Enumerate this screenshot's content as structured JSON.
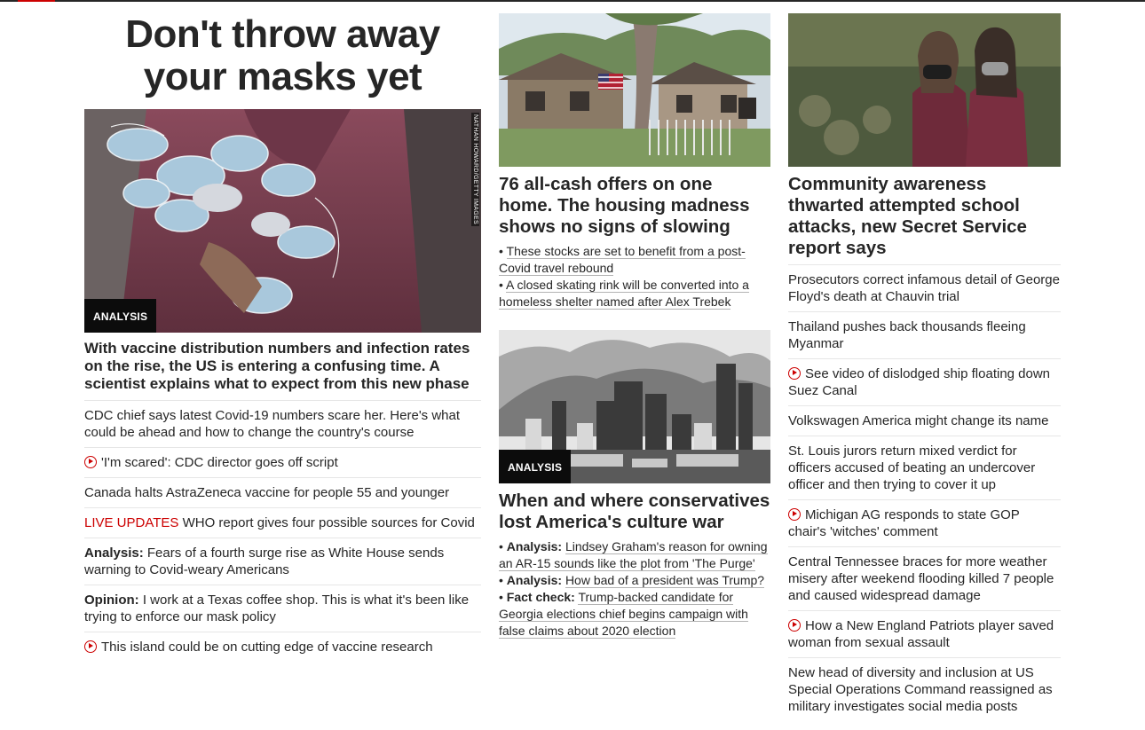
{
  "column1": {
    "banner": "Don't throw away your masks yet",
    "image": {
      "badge": "ANALYSIS",
      "credit": "NATHAN HOWARD/GETTY IMAGES"
    },
    "headline": "With vaccine distribution numbers and infection rates on the rise, the US is entering a confusing time. A scientist explains what to expect from this new phase",
    "items": [
      {
        "text": "CDC chief says latest Covid-19 numbers scare her. Here's what could be ahead and how to change the country's course"
      },
      {
        "text": "'I'm scared': CDC director goes off script",
        "icon": "play-icon"
      },
      {
        "text": "Canada halts AstraZeneca vaccine for people 55 and younger"
      },
      {
        "prefix": "LIVE UPDATES",
        "text": "WHO report gives four possible sources for Covid"
      },
      {
        "prefix": "Analysis:",
        "text": "Fears of a fourth surge rise as White House sends warning to Covid-weary Americans"
      },
      {
        "prefix": "Opinion:",
        "text": "I work at a Texas coffee shop. This is what it's been like trying to enforce our mask policy"
      },
      {
        "text": "This island could be on cutting edge of vaccine research",
        "icon": "play-icon"
      }
    ]
  },
  "column2": {
    "story1": {
      "headline": "76 all-cash offers on one home. The housing madness shows no signs of slowing",
      "bullets": [
        {
          "text": "These stocks are set to benefit from a post-Covid travel rebound"
        },
        {
          "text": "A closed skating rink will be converted into a homeless shelter named after Alex Trebek"
        }
      ]
    },
    "story2": {
      "badge": "ANALYSIS",
      "headline": "When and where conservatives lost America's culture war",
      "bullets": [
        {
          "prefix": "Analysis:",
          "text": "Lindsey Graham's reason for owning an AR-15 sounds like the plot from 'The Purge'"
        },
        {
          "prefix": "Analysis:",
          "text": "How bad of a president was Trump?"
        },
        {
          "prefix": "Fact check:",
          "text": "Trump-backed candidate for Georgia elections chief begins campaign with false claims about 2020 election"
        }
      ]
    }
  },
  "column3": {
    "headline": "Community awareness thwarted attempted school attacks, new Secret Service report says",
    "items": [
      {
        "text": "Prosecutors correct infamous detail of George Floyd's death at Chauvin trial"
      },
      {
        "text": "Thailand pushes back thousands fleeing Myanmar"
      },
      {
        "text": "See video of dislodged ship floating down Suez Canal",
        "icon": "play-icon"
      },
      {
        "text": "Volkswagen America might change its name"
      },
      {
        "text": "St. Louis jurors return mixed verdict for officers accused of beating an undercover officer and then trying to cover it up"
      },
      {
        "text": "Michigan AG responds to state GOP chair's 'witches' comment",
        "icon": "play-icon"
      },
      {
        "text": "Central Tennessee braces for more weather misery after weekend flooding killed 7 people and caused widespread damage"
      },
      {
        "text": "How a New England Patriots player saved woman from sexual assault",
        "icon": "play-icon"
      },
      {
        "text": "New head of diversity and inclusion at US Special Operations Command reassigned as military investigates social media posts"
      }
    ]
  },
  "colors": {
    "accent": "#cc0000",
    "text": "#262626",
    "divider": "#e6e6e6",
    "badge": "#0c0c0c"
  }
}
